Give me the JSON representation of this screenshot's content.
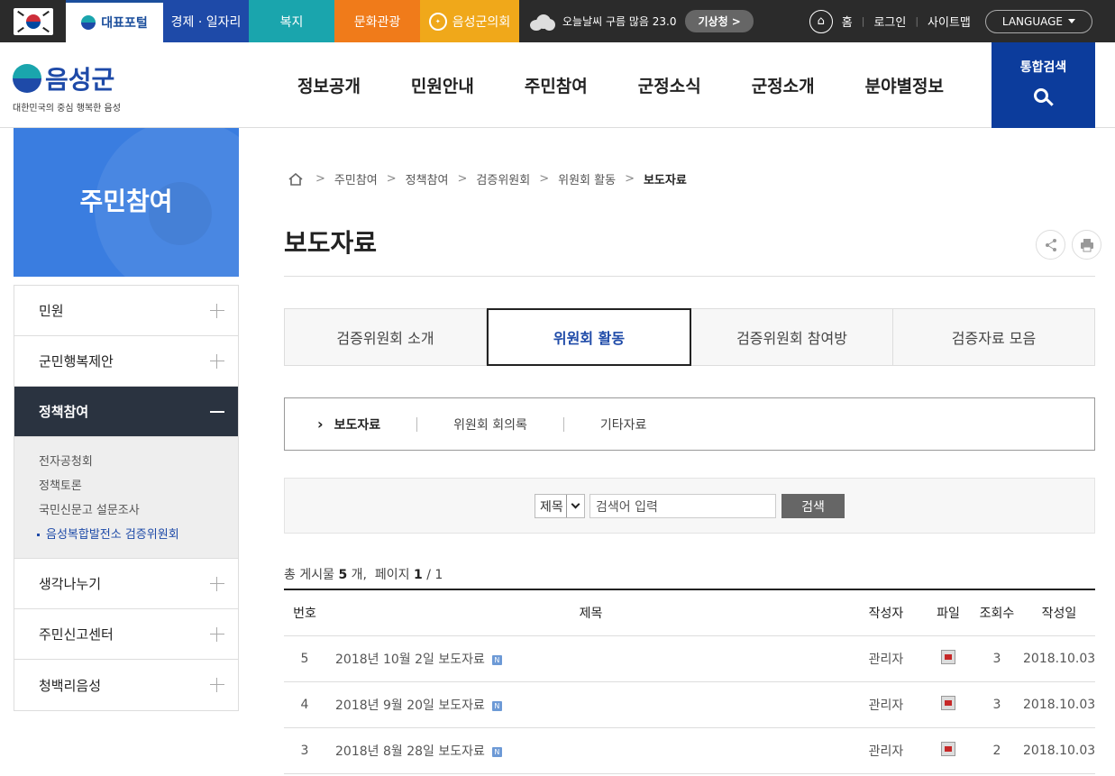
{
  "topbar": {
    "tabs": [
      "대표포털",
      "경제 · 일자리",
      "복지",
      "문화관광",
      "음성군의회"
    ],
    "weather": "오늘날씨 구름 많음 23.0",
    "weather_button": "기상청 >",
    "links": [
      "홈",
      "로그인",
      "사이트맵"
    ],
    "language": "LANGUAGE"
  },
  "header": {
    "brand": "음성군",
    "brand_sub": "대한민국의 중심 행복한 음성",
    "gnb": [
      "정보공개",
      "민원안내",
      "주민참여",
      "군정소식",
      "군정소개",
      "분야별정보"
    ],
    "search_label": "통합검색"
  },
  "lnb": {
    "title": "주민참여",
    "items": [
      {
        "label": "민원"
      },
      {
        "label": "군민행복제안"
      },
      {
        "label": "정책참여"
      },
      {
        "label": "생각나누기"
      },
      {
        "label": "주민신고센터"
      },
      {
        "label": "청백리음성"
      }
    ],
    "sub_items": [
      "전자공청회",
      "정책토론",
      "국민신문고 설문조사",
      "음성복합발전소 검증위원회"
    ]
  },
  "breadcrumb": [
    "주민참여",
    "정책참여",
    "검증위원회",
    "위원회 활동",
    "보도자료"
  ],
  "page_title": "보도자료",
  "tabs": [
    "검증위원회 소개",
    "위원회 활동",
    "검증위원회 참여방",
    "검증자료 모음"
  ],
  "subtabs": [
    "보도자료",
    "위원회 회의록",
    "기타자료"
  ],
  "search": {
    "select": "제목",
    "placeholder": "검색어 입력",
    "button": "검색"
  },
  "total": {
    "prefix": "총 게시물",
    "count": "5",
    "unit": "개,",
    "page_label": "페이지",
    "page": "1",
    "pages": "/ 1"
  },
  "table": {
    "headers": [
      "번호",
      "제목",
      "작성자",
      "파일",
      "조회수",
      "작성일"
    ],
    "rows": [
      {
        "no": "5",
        "title": "2018년 10월 2일 보도자료",
        "author": "관리자",
        "views": "3",
        "date": "2018.10.03"
      },
      {
        "no": "4",
        "title": "2018년 9월 20일 보도자료",
        "author": "관리자",
        "views": "3",
        "date": "2018.10.03"
      },
      {
        "no": "3",
        "title": "2018년 8월 28일 보도자료",
        "author": "관리자",
        "views": "2",
        "date": "2018.10.03"
      }
    ],
    "new_badge": "N"
  }
}
